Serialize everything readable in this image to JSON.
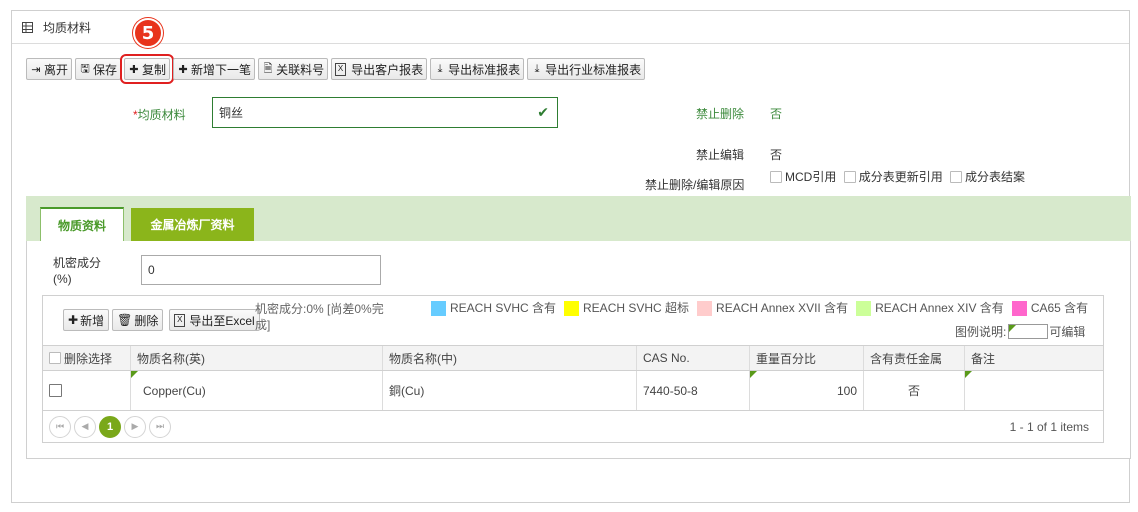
{
  "panel": {
    "title": "均质材料"
  },
  "toolbar": {
    "buttons": [
      {
        "label": "离开",
        "icon": "exit-icon"
      },
      {
        "label": "保存",
        "icon": "save-icon"
      },
      {
        "label": "复制",
        "icon": "plus-icon"
      },
      {
        "label": "新增下一笔",
        "icon": "plus-icon"
      },
      {
        "label": "关联料号",
        "icon": "document-icon"
      },
      {
        "label": "导出客户报表",
        "icon": "excel-icon"
      },
      {
        "label": "导出标准报表",
        "icon": "download-icon"
      },
      {
        "label": "导出行业标准报表",
        "icon": "download-icon"
      }
    ],
    "step_badge": "5"
  },
  "form": {
    "material_label_required": "*",
    "material_label": "均质材料",
    "material_value": "铜丝",
    "no_delete_label": "禁止删除",
    "no_delete_value": "否",
    "no_edit_label": "禁止编辑",
    "no_edit_value": "否",
    "reason_label": "禁止删除/编辑原因",
    "reasons": [
      "MCD引用",
      "成分表更新引用",
      "成分表结案"
    ]
  },
  "tabs": [
    {
      "label": "物质资料",
      "active": true
    },
    {
      "label": "金属冶炼厂资料",
      "active": false
    }
  ],
  "secret": {
    "label": "机密成分\n(%)",
    "value": "0"
  },
  "grid": {
    "btn_add": "新增",
    "btn_delete": "删除",
    "btn_export": "导出至Excel",
    "secret_note": "机密成分:0% [尚差0%完成]",
    "legend": [
      {
        "label": "REACH SVHC 含有",
        "color": "#66ccff"
      },
      {
        "label": "REACH SVHC 超标",
        "color": "#ffff00"
      },
      {
        "label": "REACH Annex XVII 含有",
        "color": "#ffcccc"
      },
      {
        "label": "REACH Annex XIV 含有",
        "color": "#ccff99"
      },
      {
        "label": "CA65 含有",
        "color": "#ff66cc"
      }
    ],
    "legend_caption": "图例说明:",
    "editable_label": "可编辑",
    "headers": [
      "删除选择",
      "物质名称(英)",
      "物质名称(中)",
      "CAS No.",
      "重量百分比",
      "含有责任金属",
      "备注"
    ],
    "rows": [
      {
        "name_en": "Copper(Cu)",
        "name_cn": "銅(Cu)",
        "cas": "7440-50-8",
        "weight": "100",
        "metal": "否",
        "note": ""
      }
    ],
    "pager": {
      "current": "1",
      "summary": "1 - 1 of 1 items"
    }
  }
}
